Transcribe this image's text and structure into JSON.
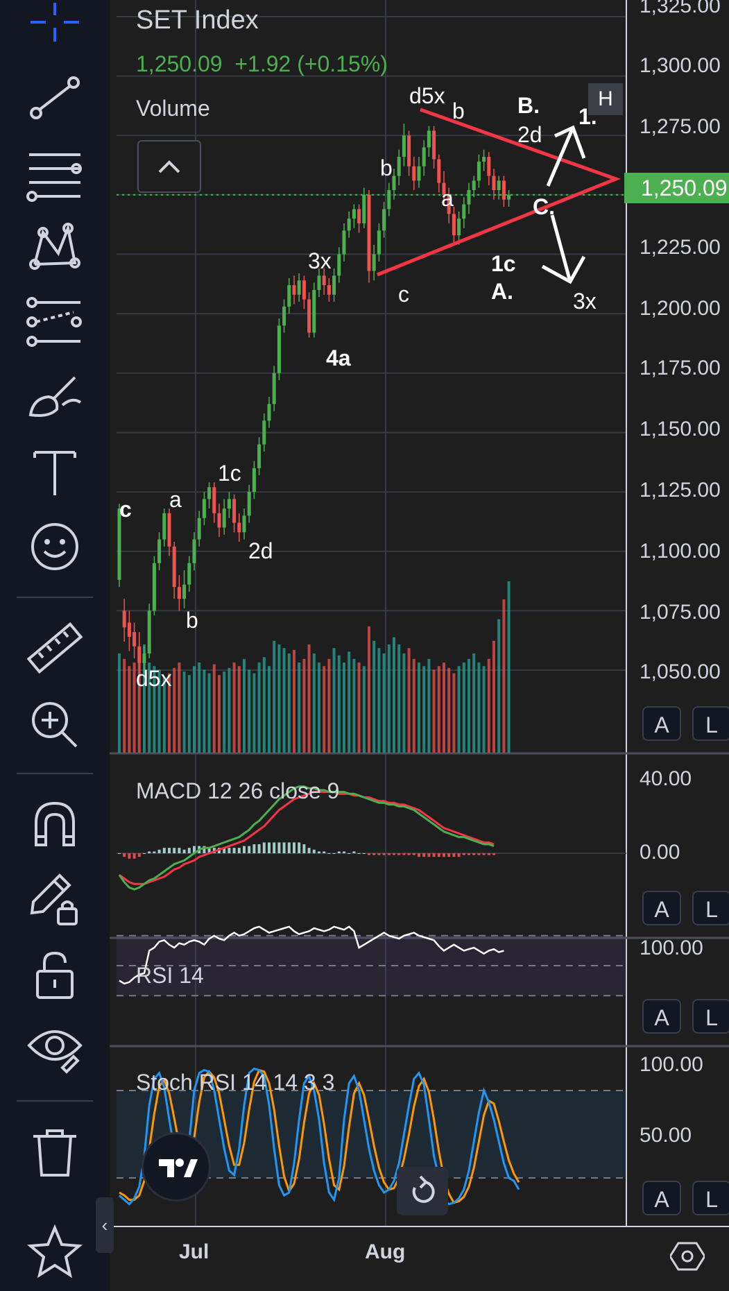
{
  "symbol": {
    "name": "SET Index",
    "last": "1,250.09",
    "change": "+1.92",
    "change_pct": "(+0.15%)"
  },
  "colors": {
    "up": "#4caf50",
    "down": "#ef5350",
    "vol_up": "#26a69a",
    "vol_down": "#ef5350",
    "pattern_line": "#f23645",
    "macd_line": "#4caf50",
    "signal_line": "#f23645",
    "rsi_line": "#ffffff",
    "stoch_k": "#2196f3",
    "stoch_d": "#ff9800"
  },
  "toolbar": {
    "icons": [
      "crosshair-icon",
      "trend-line-icon",
      "fib-retracement-icon",
      "xabcd-pattern-icon",
      "forecast-icon",
      "brush-icon",
      "text-icon",
      "emoji-icon",
      "ruler-icon",
      "zoom-in-icon",
      "magnet-icon",
      "lock-drawing-icon",
      "unlock-icon",
      "eye-icon",
      "trash-icon",
      "star-icon"
    ]
  },
  "main_pane": {
    "volume_label": "Volume",
    "badge_h": "H",
    "price_tag": "1,250.09",
    "y_labels": [
      "1,325.00",
      "1,300.00",
      "1,275.00",
      "1,225.00",
      "1,200.00",
      "1,175.00",
      "1,150.00",
      "1,125.00",
      "1,100.00",
      "1,075.00",
      "1,050.00"
    ],
    "annotations": [
      {
        "text": "c",
        "bold": true
      },
      {
        "text": "a",
        "bold": false
      },
      {
        "text": "b",
        "bold": false
      },
      {
        "text": "d5x",
        "bold": false
      },
      {
        "text": "1c",
        "bold": false
      },
      {
        "text": "2d",
        "bold": false
      },
      {
        "text": "3x",
        "bold": false
      },
      {
        "text": "4a",
        "bold": true
      },
      {
        "text": "b",
        "bold": false
      },
      {
        "text": "c",
        "bold": false
      },
      {
        "text": "d5x",
        "bold": false
      },
      {
        "text": "b",
        "bold": false
      },
      {
        "text": "a",
        "bold": false
      },
      {
        "text": "B.",
        "bold": true
      },
      {
        "text": "2d",
        "bold": false
      },
      {
        "text": "1.",
        "bold": true
      },
      {
        "text": "C.",
        "bold": true
      },
      {
        "text": "1c",
        "bold": true
      },
      {
        "text": "A.",
        "bold": true
      },
      {
        "text": "3x",
        "bold": false
      }
    ]
  },
  "panes": {
    "macd": {
      "label": "MACD  12 26 close 9",
      "y_labels": [
        "40.00",
        "0.00"
      ]
    },
    "rsi": {
      "label": "RSI  14",
      "y_labels": [
        "100.00"
      ]
    },
    "stoch": {
      "label": "Stoch RSI  14 14 3 3",
      "y_labels": [
        "100.00",
        "50.00"
      ]
    }
  },
  "scale_buttons": {
    "auto": "A",
    "log": "L"
  },
  "x_axis": {
    "labels": [
      "Jul",
      "Aug"
    ]
  },
  "controls": {
    "collapse_label": "‹"
  },
  "chart_data": {
    "type": "candlestick",
    "price_axis_range": [
      1040,
      1330
    ],
    "candles": [
      {
        "o": 1088,
        "c": 1118,
        "h": 1120,
        "l": 1085
      },
      {
        "o": 1075,
        "c": 1068,
        "h": 1080,
        "l": 1062
      },
      {
        "o": 1070,
        "c": 1064,
        "h": 1075,
        "l": 1058
      },
      {
        "o": 1066,
        "c": 1060,
        "h": 1070,
        "l": 1055
      },
      {
        "o": 1060,
        "c": 1053,
        "h": 1066,
        "l": 1048
      },
      {
        "o": 1053,
        "c": 1057,
        "h": 1060,
        "l": 1049
      },
      {
        "o": 1057,
        "c": 1075,
        "h": 1078,
        "l": 1055
      },
      {
        "o": 1075,
        "c": 1095,
        "h": 1098,
        "l": 1073
      },
      {
        "o": 1095,
        "c": 1105,
        "h": 1108,
        "l": 1092
      },
      {
        "o": 1105,
        "c": 1116,
        "h": 1118,
        "l": 1102
      },
      {
        "o": 1116,
        "c": 1102,
        "h": 1118,
        "l": 1098
      },
      {
        "o": 1102,
        "c": 1085,
        "h": 1104,
        "l": 1080
      },
      {
        "o": 1085,
        "c": 1080,
        "h": 1090,
        "l": 1075
      },
      {
        "o": 1080,
        "c": 1086,
        "h": 1092,
        "l": 1076
      },
      {
        "o": 1086,
        "c": 1095,
        "h": 1098,
        "l": 1083
      },
      {
        "o": 1095,
        "c": 1105,
        "h": 1108,
        "l": 1092
      },
      {
        "o": 1105,
        "c": 1114,
        "h": 1117,
        "l": 1102
      },
      {
        "o": 1114,
        "c": 1122,
        "h": 1125,
        "l": 1111
      },
      {
        "o": 1122,
        "c": 1127,
        "h": 1129,
        "l": 1118
      },
      {
        "o": 1127,
        "c": 1116,
        "h": 1129,
        "l": 1112
      },
      {
        "o": 1116,
        "c": 1110,
        "h": 1120,
        "l": 1106
      },
      {
        "o": 1110,
        "c": 1118,
        "h": 1122,
        "l": 1107
      },
      {
        "o": 1118,
        "c": 1122,
        "h": 1125,
        "l": 1114
      },
      {
        "o": 1122,
        "c": 1112,
        "h": 1124,
        "l": 1108
      },
      {
        "o": 1112,
        "c": 1108,
        "h": 1116,
        "l": 1104
      },
      {
        "o": 1108,
        "c": 1115,
        "h": 1118,
        "l": 1105
      },
      {
        "o": 1115,
        "c": 1125,
        "h": 1128,
        "l": 1112
      },
      {
        "o": 1125,
        "c": 1135,
        "h": 1138,
        "l": 1122
      },
      {
        "o": 1135,
        "c": 1145,
        "h": 1148,
        "l": 1132
      },
      {
        "o": 1145,
        "c": 1155,
        "h": 1158,
        "l": 1142
      },
      {
        "o": 1155,
        "c": 1162,
        "h": 1165,
        "l": 1152
      },
      {
        "o": 1162,
        "c": 1175,
        "h": 1178,
        "l": 1159
      },
      {
        "o": 1175,
        "c": 1195,
        "h": 1198,
        "l": 1172
      },
      {
        "o": 1195,
        "c": 1203,
        "h": 1206,
        "l": 1192
      },
      {
        "o": 1203,
        "c": 1212,
        "h": 1215,
        "l": 1200
      },
      {
        "o": 1212,
        "c": 1208,
        "h": 1216,
        "l": 1204
      },
      {
        "o": 1208,
        "c": 1214,
        "h": 1217,
        "l": 1205
      },
      {
        "o": 1214,
        "c": 1206,
        "h": 1216,
        "l": 1202
      },
      {
        "o": 1206,
        "c": 1192,
        "h": 1209,
        "l": 1190
      },
      {
        "o": 1192,
        "c": 1210,
        "h": 1213,
        "l": 1190
      },
      {
        "o": 1210,
        "c": 1216,
        "h": 1219,
        "l": 1207
      },
      {
        "o": 1216,
        "c": 1212,
        "h": 1219,
        "l": 1208
      },
      {
        "o": 1212,
        "c": 1208,
        "h": 1215,
        "l": 1205
      },
      {
        "o": 1208,
        "c": 1216,
        "h": 1219,
        "l": 1205
      },
      {
        "o": 1216,
        "c": 1225,
        "h": 1228,
        "l": 1213
      },
      {
        "o": 1225,
        "c": 1235,
        "h": 1238,
        "l": 1222
      },
      {
        "o": 1235,
        "c": 1240,
        "h": 1243,
        "l": 1232
      },
      {
        "o": 1240,
        "c": 1244,
        "h": 1246,
        "l": 1236
      },
      {
        "o": 1244,
        "c": 1238,
        "h": 1246,
        "l": 1234
      },
      {
        "o": 1238,
        "c": 1250,
        "h": 1253,
        "l": 1236
      },
      {
        "o": 1250,
        "c": 1218,
        "h": 1252,
        "l": 1213
      },
      {
        "o": 1218,
        "c": 1225,
        "h": 1229,
        "l": 1214
      },
      {
        "o": 1225,
        "c": 1235,
        "h": 1238,
        "l": 1222
      },
      {
        "o": 1235,
        "c": 1244,
        "h": 1247,
        "l": 1232
      },
      {
        "o": 1244,
        "c": 1252,
        "h": 1255,
        "l": 1241
      },
      {
        "o": 1252,
        "c": 1258,
        "h": 1261,
        "l": 1248
      },
      {
        "o": 1258,
        "c": 1266,
        "h": 1269,
        "l": 1254
      },
      {
        "o": 1266,
        "c": 1275,
        "h": 1280,
        "l": 1262
      },
      {
        "o": 1275,
        "c": 1262,
        "h": 1277,
        "l": 1258
      },
      {
        "o": 1262,
        "c": 1256,
        "h": 1266,
        "l": 1252
      },
      {
        "o": 1256,
        "c": 1262,
        "h": 1266,
        "l": 1253
      },
      {
        "o": 1262,
        "c": 1270,
        "h": 1273,
        "l": 1258
      },
      {
        "o": 1270,
        "c": 1277,
        "h": 1279,
        "l": 1266
      },
      {
        "o": 1277,
        "c": 1265,
        "h": 1279,
        "l": 1261
      },
      {
        "o": 1265,
        "c": 1255,
        "h": 1267,
        "l": 1251
      },
      {
        "o": 1255,
        "c": 1250,
        "h": 1260,
        "l": 1246
      },
      {
        "o": 1250,
        "c": 1242,
        "h": 1253,
        "l": 1238
      },
      {
        "o": 1242,
        "c": 1233,
        "h": 1245,
        "l": 1230
      },
      {
        "o": 1233,
        "c": 1240,
        "h": 1243,
        "l": 1229
      },
      {
        "o": 1240,
        "c": 1246,
        "h": 1249,
        "l": 1236
      },
      {
        "o": 1246,
        "c": 1252,
        "h": 1255,
        "l": 1242
      },
      {
        "o": 1252,
        "c": 1256,
        "h": 1258,
        "l": 1249
      },
      {
        "o": 1256,
        "c": 1264,
        "h": 1267,
        "l": 1253
      },
      {
        "o": 1264,
        "c": 1266,
        "h": 1269,
        "l": 1260
      },
      {
        "o": 1266,
        "c": 1258,
        "h": 1268,
        "l": 1254
      },
      {
        "o": 1258,
        "c": 1252,
        "h": 1261,
        "l": 1248
      },
      {
        "o": 1252,
        "c": 1256,
        "h": 1258,
        "l": 1248
      },
      {
        "o": 1256,
        "c": 1248,
        "h": 1258,
        "l": 1245
      },
      {
        "o": 1248,
        "c": 1250,
        "h": 1252,
        "l": 1245
      }
    ],
    "volume_rel": [
      0.55,
      0.52,
      0.48,
      0.5,
      0.58,
      0.6,
      0.5,
      0.48,
      0.46,
      0.42,
      0.44,
      0.47,
      0.5,
      0.45,
      0.43,
      0.48,
      0.5,
      0.46,
      0.44,
      0.49,
      0.43,
      0.45,
      0.47,
      0.5,
      0.48,
      0.52,
      0.46,
      0.44,
      0.5,
      0.53,
      0.48,
      0.62,
      0.6,
      0.58,
      0.55,
      0.57,
      0.5,
      0.52,
      0.6,
      0.55,
      0.5,
      0.48,
      0.52,
      0.58,
      0.54,
      0.5,
      0.56,
      0.52,
      0.5,
      0.48,
      0.7,
      0.62,
      0.58,
      0.55,
      0.6,
      0.64,
      0.6,
      0.55,
      0.58,
      0.52,
      0.5,
      0.48,
      0.52,
      0.46,
      0.48,
      0.5,
      0.47,
      0.44,
      0.48,
      0.5,
      0.52,
      0.55,
      0.5,
      0.48,
      0.52,
      0.62,
      0.74,
      0.85,
      0.95
    ],
    "macd": [
      -12,
      -16,
      -19,
      -20,
      -19,
      -17,
      -15,
      -14,
      -12,
      -10,
      -8,
      -6,
      -5,
      -4,
      -2,
      0,
      2,
      3,
      3,
      4,
      5,
      6,
      7,
      8,
      9,
      11,
      13,
      16,
      18,
      21,
      24,
      27,
      30,
      32,
      34,
      36,
      37,
      37,
      36,
      36,
      35,
      35,
      34,
      34,
      34,
      34,
      33,
      33,
      32,
      31,
      30,
      29,
      28,
      28,
      27,
      27,
      26,
      26,
      25,
      24,
      22,
      20,
      18,
      16,
      14,
      12,
      11,
      10,
      9,
      9,
      8,
      7,
      6,
      5,
      5,
      4
    ],
    "signal": [
      -12,
      -14,
      -16,
      -17,
      -17,
      -17,
      -16,
      -15,
      -14,
      -13,
      -11,
      -9,
      -8,
      -6,
      -5,
      -4,
      -2,
      -1,
      0,
      1,
      2,
      3,
      4,
      5,
      6,
      7,
      9,
      11,
      13,
      15,
      18,
      21,
      24,
      26,
      28,
      30,
      31,
      32,
      33,
      34,
      34,
      34,
      34,
      34,
      33,
      33,
      33,
      32,
      32,
      31,
      31,
      30,
      29,
      29,
      28,
      28,
      27,
      27,
      26,
      25,
      24,
      22,
      20,
      18,
      16,
      14,
      13,
      12,
      11,
      10,
      9,
      8,
      7,
      6,
      6,
      5
    ],
    "rsi": [
      40,
      38,
      39,
      42,
      44,
      45,
      60,
      62,
      66,
      67,
      64,
      62,
      65,
      64,
      66,
      67,
      66,
      64,
      68,
      70,
      68,
      67,
      70,
      72,
      70,
      71,
      73,
      75,
      76,
      74,
      72,
      73,
      74,
      75,
      76,
      73,
      71,
      72,
      73,
      75,
      74,
      73,
      74,
      76,
      75,
      74,
      76,
      73,
      62,
      64,
      66,
      68,
      70,
      72,
      70,
      69,
      68,
      70,
      71,
      72,
      70,
      69,
      68,
      67,
      63,
      60,
      62,
      64,
      62,
      60,
      61,
      62,
      60,
      58,
      60,
      61,
      59,
      60
    ],
    "stoch_k": [
      8,
      5,
      2,
      6,
      14,
      35,
      70,
      88,
      92,
      82,
      60,
      40,
      28,
      20,
      45,
      80,
      92,
      94,
      93,
      80,
      60,
      40,
      25,
      22,
      40,
      70,
      92,
      95,
      94,
      90,
      70,
      40,
      15,
      8,
      10,
      30,
      60,
      85,
      90,
      80,
      60,
      30,
      10,
      5,
      20,
      60,
      85,
      90,
      80,
      60,
      40,
      25,
      15,
      10,
      12,
      18,
      30,
      50,
      70,
      88,
      92,
      84,
      60,
      35,
      20,
      5,
      2,
      3,
      6,
      12,
      25,
      45,
      65,
      80,
      72,
      60,
      45,
      30,
      20,
      18,
      12
    ],
    "stoch_d": [
      10,
      8,
      5,
      5,
      8,
      18,
      40,
      64,
      83,
      87,
      78,
      61,
      43,
      29,
      31,
      48,
      72,
      89,
      93,
      89,
      78,
      60,
      42,
      29,
      29,
      44,
      67,
      86,
      94,
      93,
      85,
      67,
      42,
      21,
      11,
      16,
      33,
      58,
      78,
      85,
      77,
      57,
      33,
      15,
      12,
      28,
      55,
      78,
      85,
      77,
      60,
      42,
      27,
      17,
      12,
      13,
      20,
      33,
      50,
      69,
      83,
      88,
      79,
      60,
      38,
      20,
      9,
      3,
      4,
      7,
      14,
      27,
      45,
      63,
      73,
      71,
      59,
      45,
      32,
      23,
      17
    ]
  }
}
